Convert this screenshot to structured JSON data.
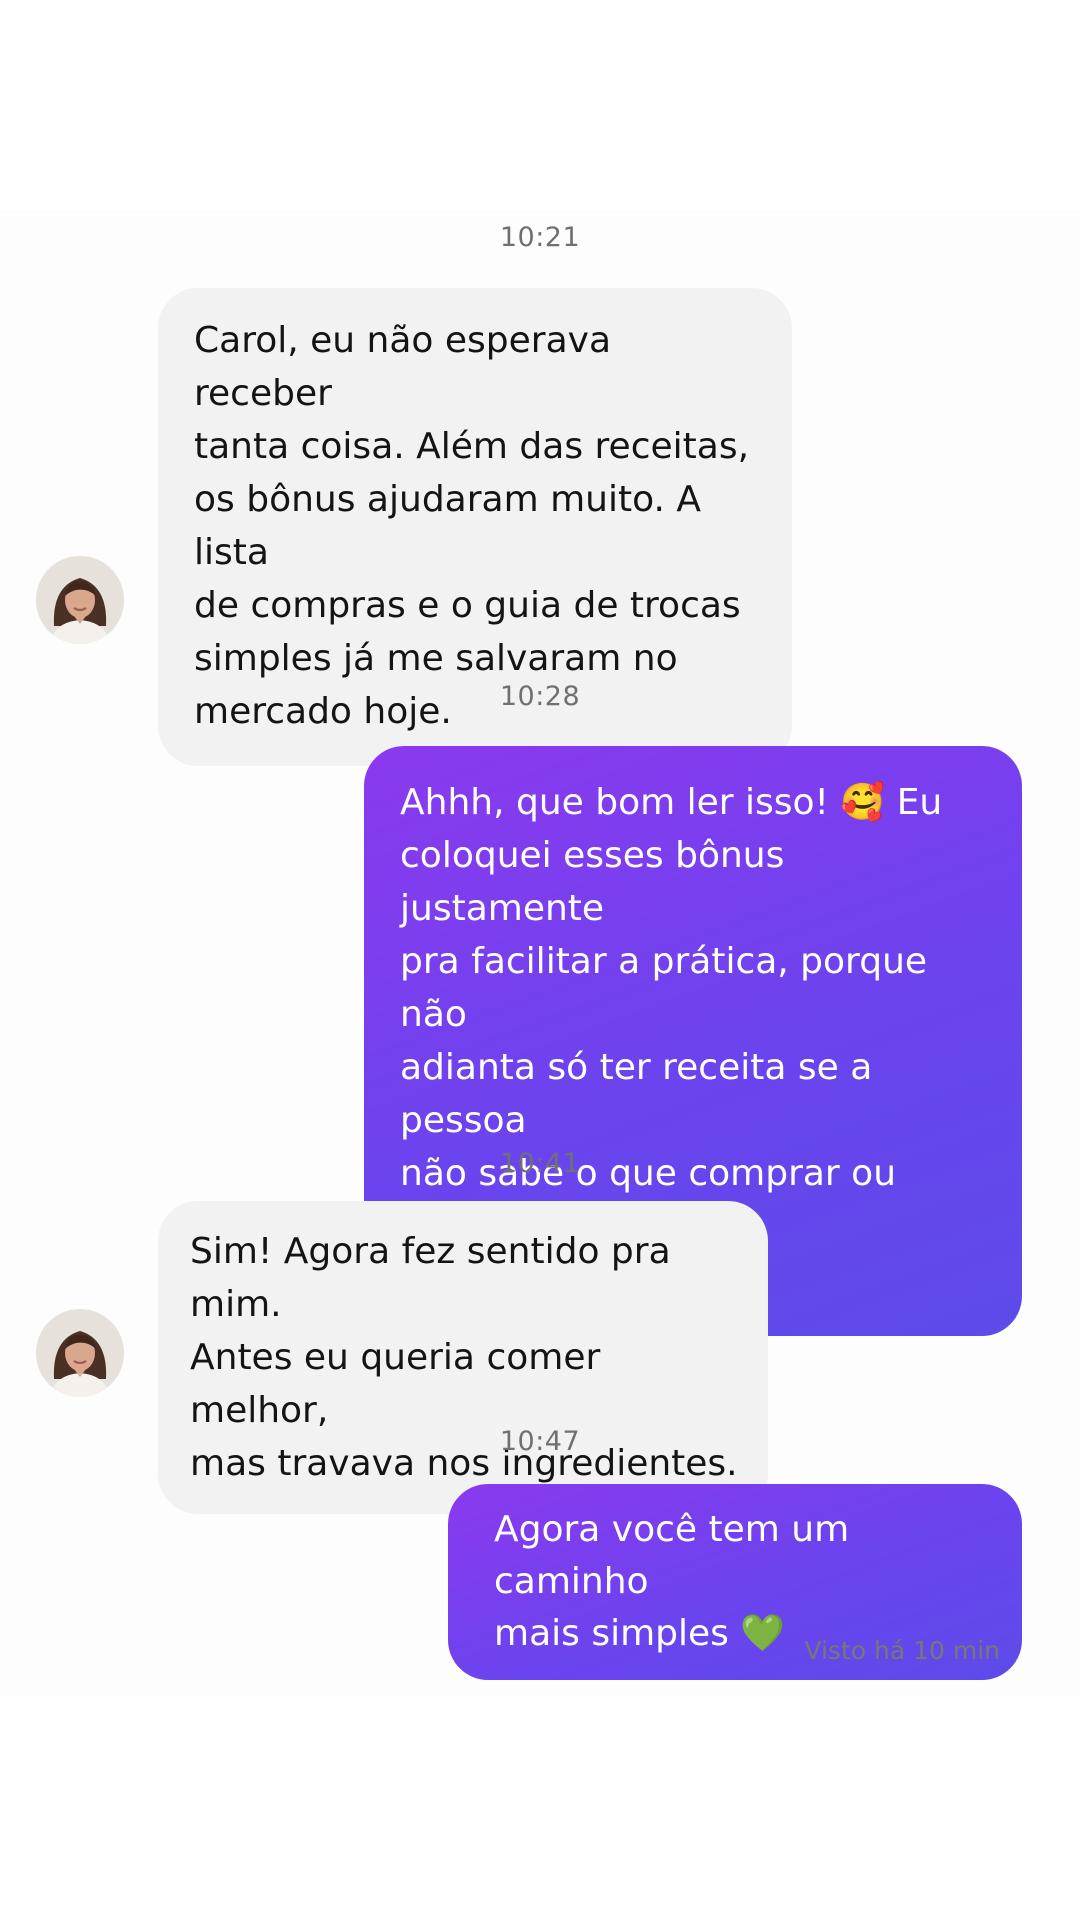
{
  "conversation": {
    "messages": [
      {
        "time": "10:21",
        "direction": "incoming",
        "text": "Carol, eu não esperava receber\ntanta coisa. Além das receitas,\nos bônus ajudaram muito. A lista\nde compras e o guia de trocas\nsimples já me salvaram no\nmercado hoje."
      },
      {
        "time": "10:28",
        "direction": "outgoing",
        "text": "Ahhh, que bom ler isso! 🥰 Eu\ncoloquei esses bônus justamente\npra facilitar a prática, porque não\nadianta só ter receita se a pessoa\nnão sabe o que comprar ou como\nsubstituir."
      },
      {
        "time": "10:41",
        "direction": "incoming",
        "text": "Sim! Agora fez sentido pra mim.\nAntes eu queria comer melhor,\nmas travava nos ingredientes."
      },
      {
        "time": "10:47",
        "direction": "outgoing",
        "text": "Agora você tem um caminho\nmais simples 💚"
      }
    ],
    "seen_status": "Visto há 10 min"
  },
  "colors": {
    "incoming_bubble": "#f2f2f2",
    "outgoing_gradient_start": "#8b39ee",
    "outgoing_gradient_end": "#5d4be9",
    "timestamp_text": "#707070"
  },
  "icons": {
    "avatar": "contact-avatar-photo"
  }
}
